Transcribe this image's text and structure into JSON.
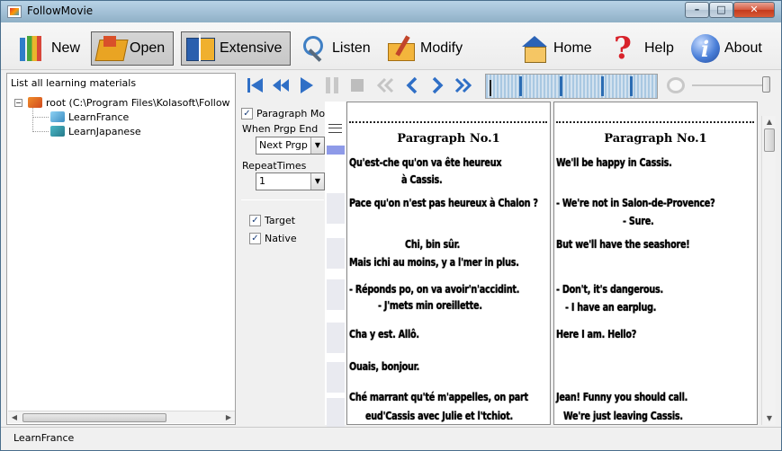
{
  "window": {
    "title": "FollowMovie"
  },
  "toolbar": {
    "new_label": "New",
    "open_label": "Open",
    "extensive_label": "Extensive",
    "listen_label": "Listen",
    "modify_label": "Modify",
    "home_label": "Home",
    "help_label": "Help",
    "about_label": "About"
  },
  "left_panel": {
    "header": "List all learning materials",
    "root_label": "root (C:\\Program Files\\Kolasoft\\Follow",
    "items": [
      "LearnFrance",
      "LearnJapanese"
    ]
  },
  "options": {
    "paragraph_mode_label": "Paragraph Mode",
    "paragraph_mode_checked": true,
    "when_end_label": "When Prgp End",
    "when_end_value": "Next Prgp",
    "repeat_label": "RepeatTimes",
    "repeat_value": "1",
    "target_label": "Target",
    "target_checked": true,
    "native_label": "Native",
    "native_checked": true
  },
  "target_pane": {
    "title": "Paragraph No.1",
    "lines": [
      "Qu'est-che qu'on va ête heureux",
      "à Cassis.",
      "Pace qu'on n'est pas heureux à Chalon ?",
      "Chi, bin sûr.",
      "Mais ichi au moins, y a l'mer in plus.",
      "- Réponds po, on va avoir'n'accidint.",
      "- J'mets min oreillette.",
      "Cha y est. Allô.",
      "Ouais, bonjour.",
      "Ché marrant qu'té m'appelles, on part",
      "eud'Cassis avec Julie et l'tchiot."
    ]
  },
  "native_pane": {
    "title": "Paragraph No.1",
    "lines": [
      "We'll be happy in Cassis.",
      "- We're not in Salon-de-Provence?",
      "- Sure.",
      "But we'll have the seashore!",
      "- Don't, it's dangerous.",
      "- I have an earplug.",
      "Here I am. Hello?",
      "Jean! Funny you should call.",
      "We're just leaving Cassis."
    ]
  },
  "status": {
    "text": "LearnFrance"
  },
  "colors": {
    "accent": "#2b6cb3",
    "paragraph_indicator": "#8e9ae8"
  }
}
